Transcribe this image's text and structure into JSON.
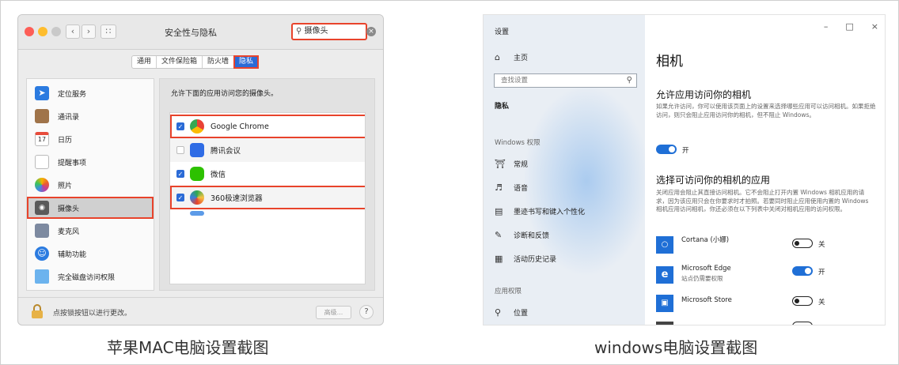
{
  "captions": {
    "mac": "苹果MAC电脑设置截图",
    "windows": "windows电脑设置截图"
  },
  "mac": {
    "title": "安全性与隐私",
    "search_value": "摄像头",
    "tabs": [
      "通用",
      "文件保险箱",
      "防火墙",
      "隐私"
    ],
    "sidebar": [
      "定位服务",
      "通讯录",
      "日历",
      "提醒事项",
      "照片",
      "摄像头",
      "麦克风",
      "辅助功能",
      "完全磁盘访问权限"
    ],
    "panel_heading": "允许下面的应用访问您的摄像头。",
    "apps": [
      {
        "name": "Google Chrome",
        "checked": true,
        "highlighted": true
      },
      {
        "name": "腾讯会议",
        "checked": false,
        "highlighted": false
      },
      {
        "name": "微信",
        "checked": true,
        "highlighted": false
      },
      {
        "name": "360极速浏览器",
        "checked": true,
        "highlighted": true
      }
    ],
    "footer_text": "点按锁按钮以进行更改。",
    "advanced_label": "高级...",
    "help_label": "?",
    "calendar_day": "17"
  },
  "windows": {
    "app_title": "设置",
    "home": "主页",
    "search_placeholder": "查找设置",
    "privacy": "隐私",
    "group_windows": "Windows 权限",
    "nav_items": [
      "常规",
      "语音",
      "墨迹书写和键入个性化",
      "诊断和反馈",
      "活动历史记录"
    ],
    "group_app": "应用权限",
    "location": "位置",
    "page_title": "相机",
    "allow_heading": "允许应用访问你的相机",
    "allow_desc": "如果允许访问，你可以使用该页面上的设置来选择哪些应用可以访问相机。如果拒绝访问，则只会阻止应用访问你的相机，但不阻止 Windows。",
    "allow_toggle_label": "开",
    "choose_heading": "选择可访问你的相机的应用",
    "choose_desc": "关闭应用会阻止其直接访问相机。它不会阻止打开内置 Windows 相机应用的请求，因为该应用只会在你要求时才拍照。若要同时阻止应用使用内置的 Windows 相机应用访问相机，你还必须在以下列表中关闭对相机应用的访问权限。",
    "apps": [
      {
        "name": "Cortana (小娜)",
        "sub": "",
        "state": "关",
        "on": false
      },
      {
        "name": "Microsoft Edge",
        "sub": "站点仍需要权限",
        "state": "开",
        "on": true
      },
      {
        "name": "Microsoft Store",
        "sub": "",
        "state": "关",
        "on": false
      }
    ],
    "window_controls": [
      "–",
      "□",
      "×"
    ]
  },
  "colors": {
    "highlight": "#e8432b",
    "mac_accent": "#2b6bd6",
    "win_accent": "#1f6fd6"
  }
}
